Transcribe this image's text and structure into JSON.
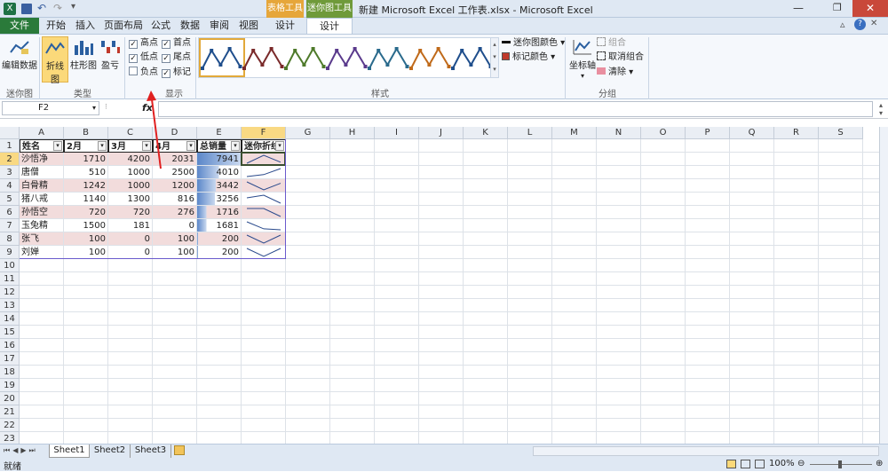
{
  "window": {
    "title": "新建 Microsoft Excel 工作表.xlsx - Microsoft Excel",
    "context_groups": [
      "表格工具",
      "迷你图工具"
    ]
  },
  "tabs": [
    "文件",
    "开始",
    "插入",
    "页面布局",
    "公式",
    "数据",
    "审阅",
    "视图",
    "设计",
    "设计"
  ],
  "ribbon": {
    "edit_data": "编辑数据",
    "line": "折线图",
    "column": "柱形图",
    "winloss": "盈亏",
    "high": "高点",
    "low": "低点",
    "negative": "负点",
    "first": "首点",
    "last": "尾点",
    "markers": "标记",
    "sparkline_color": "迷你图颜色",
    "marker_color": "标记颜色",
    "axis": "坐标轴",
    "group": "组合",
    "ungroup": "取消组合",
    "clear": "清除",
    "groups": [
      "迷你图",
      "类型",
      "显示",
      "样式",
      "分组"
    ],
    "style_colors": [
      "#1f4e8c",
      "#7a2a2a",
      "#4e7a2a",
      "#5a3a8c",
      "#2a6a8c",
      "#c06a1a",
      "#1f4e8c"
    ]
  },
  "formula_bar": {
    "name_box": "F2",
    "fx": "fx"
  },
  "grid": {
    "columns": [
      "A",
      "B",
      "C",
      "D",
      "E",
      "F",
      "G",
      "H",
      "I",
      "J",
      "K",
      "L",
      "M",
      "N",
      "O",
      "P",
      "Q",
      "R",
      "S"
    ],
    "rows": [
      "1",
      "2",
      "3",
      "4",
      "5",
      "6",
      "7",
      "8",
      "9",
      "10",
      "11",
      "12",
      "13",
      "14",
      "15",
      "16",
      "17",
      "18",
      "19",
      "20",
      "21",
      "22",
      "23"
    ],
    "headers": [
      "姓名",
      "2月",
      "3月",
      "4月",
      "总销量",
      "迷你折线"
    ],
    "data": [
      [
        "沙悟净",
        "1710",
        "4200",
        "2031",
        "7941"
      ],
      [
        "唐僧",
        "510",
        "1000",
        "2500",
        "4010"
      ],
      [
        "白骨精",
        "1242",
        "1000",
        "1200",
        "3442"
      ],
      [
        "猪八戒",
        "1140",
        "1300",
        "816",
        "3256"
      ],
      [
        "孙悟空",
        "720",
        "720",
        "276",
        "1716"
      ],
      [
        "玉兔精",
        "1500",
        "181",
        "0",
        "1681"
      ],
      [
        "张飞",
        "100",
        "0",
        "100",
        "200"
      ],
      [
        "刘婵",
        "100",
        "0",
        "100",
        "200"
      ]
    ],
    "max_total": 7941
  },
  "sheets": [
    "Sheet1",
    "Sheet2",
    "Sheet3"
  ],
  "status": {
    "ready": "就绪",
    "zoom": "100%"
  }
}
